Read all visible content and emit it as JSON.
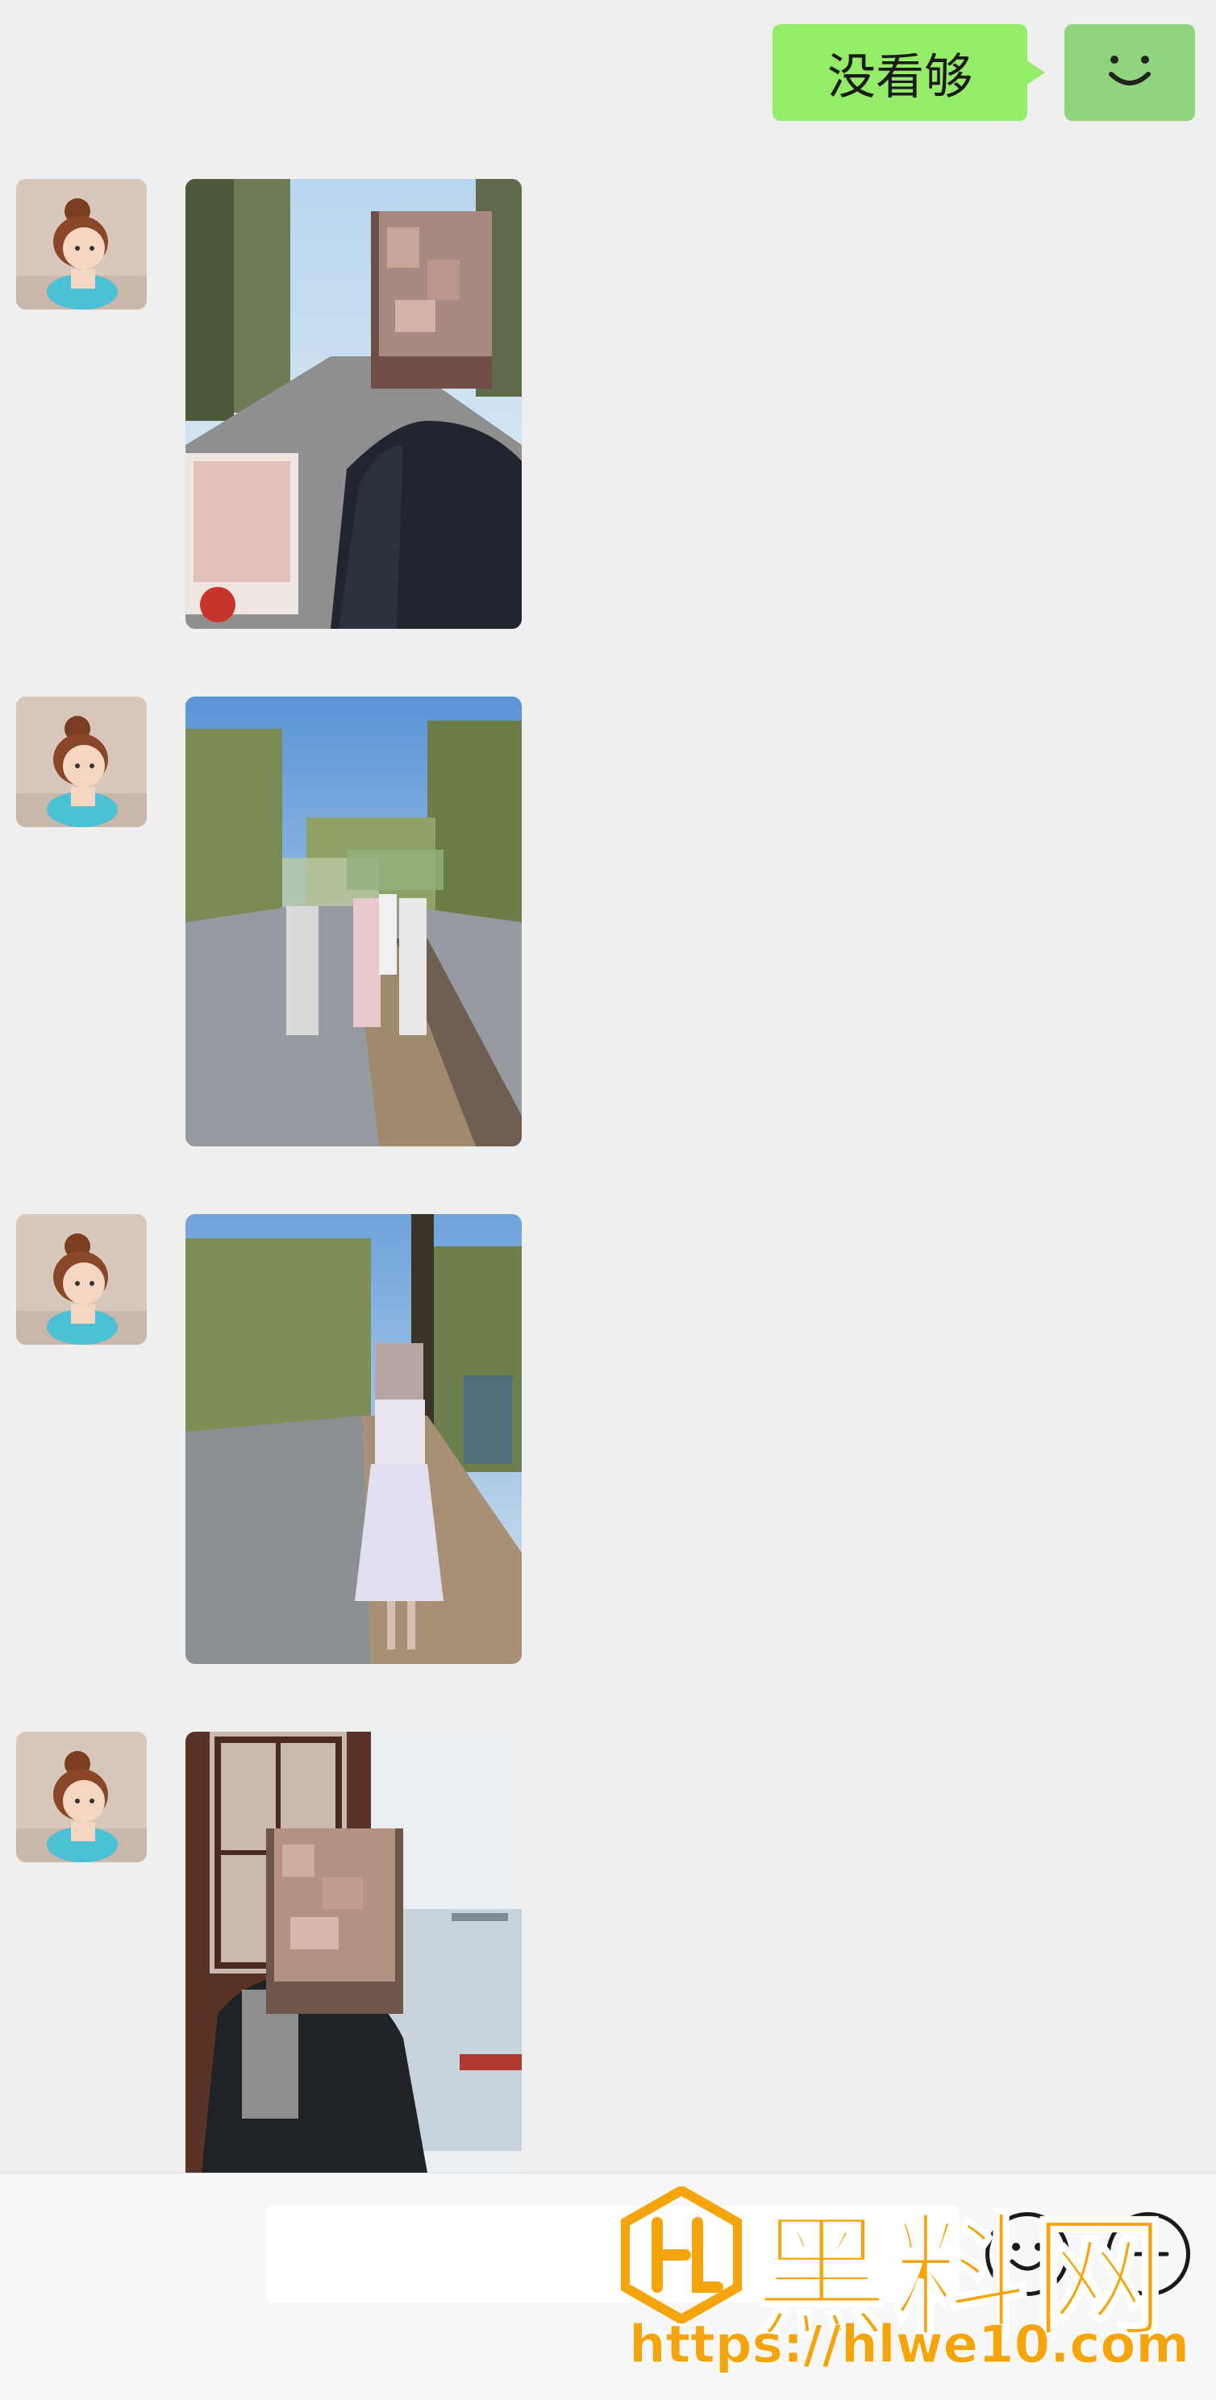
{
  "chat": {
    "outgoing": [
      {
        "text": "没看够"
      }
    ],
    "incoming_photos": [
      {
        "sender_avatar": "cartoon-girl-avatar",
        "photo": "selfie-park-road"
      },
      {
        "sender_avatar": "cartoon-girl-avatar",
        "photo": "group-walking-path"
      },
      {
        "sender_avatar": "cartoon-girl-avatar",
        "photo": "woman-white-dress-path"
      },
      {
        "sender_avatar": "cartoon-girl-avatar",
        "photo": "selfie-pavilion-lake"
      }
    ]
  },
  "input_bar": {
    "emoji_icon": "smiley-icon",
    "more_icon": "plus-icon"
  },
  "watermark": {
    "title": "黑料网",
    "url": "https://hlwe10.com"
  },
  "colors": {
    "bubble_green": "#95ec69",
    "background": "#efefef",
    "watermark_orange": "#f5a40c"
  }
}
